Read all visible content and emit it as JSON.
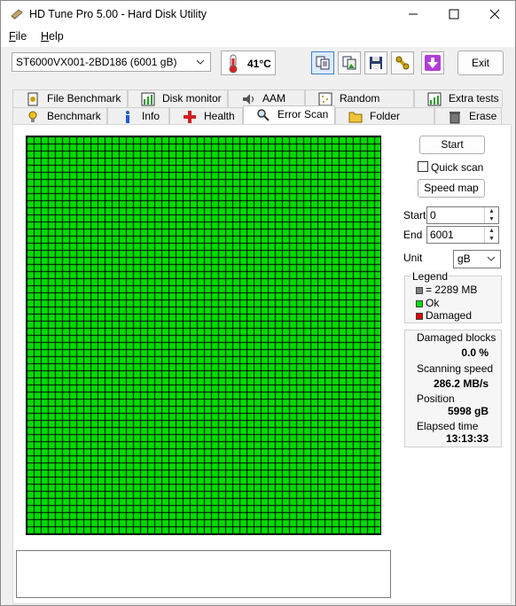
{
  "window": {
    "title": "HD Tune Pro 5.00 - Hard Disk Utility"
  },
  "menu": {
    "file": "ile",
    "file_key": "F",
    "help": "elp",
    "help_key": "H"
  },
  "toolbar": {
    "drive": "ST6000VX001-2BD186 (6001 gB)",
    "temperature": "41°C",
    "exit_label": "Exit"
  },
  "tabs_top": [
    "File Benchmark",
    "Disk monitor",
    "AAM",
    "Random Access",
    "Extra tests"
  ],
  "tabs_bottom": [
    "Benchmark",
    "Info",
    "Health",
    "Error Scan",
    "Folder Usage",
    "Erase"
  ],
  "selected_tab": "Error Scan",
  "scan": {
    "start_label": "Start",
    "quick_scan_label": "Quick scan",
    "quick_scan_checked": false,
    "speed_map_label": "Speed map",
    "start_field_label": "Start",
    "start_value": "0",
    "end_field_label": "End",
    "end_value": "6001",
    "unit_label": "Unit",
    "unit_value": "gB"
  },
  "legend": {
    "title": "Legend",
    "block": "= 2289 MB",
    "ok": "Ok",
    "damaged": "Damaged"
  },
  "stats": {
    "damaged_blocks_label": "Damaged blocks",
    "damaged_blocks_value": "0.0 %",
    "scanning_speed_label": "Scanning speed",
    "scanning_speed_value": "286.2 MB/s",
    "position_label": "Position",
    "position_value": "5998 gB",
    "elapsed_label": "Elapsed time",
    "elapsed_value": "13:13:33"
  },
  "colors": {
    "ok": "#00dd00",
    "damaged": "#dd0000",
    "unscanned": "#808080",
    "grid_line": "#000000"
  }
}
